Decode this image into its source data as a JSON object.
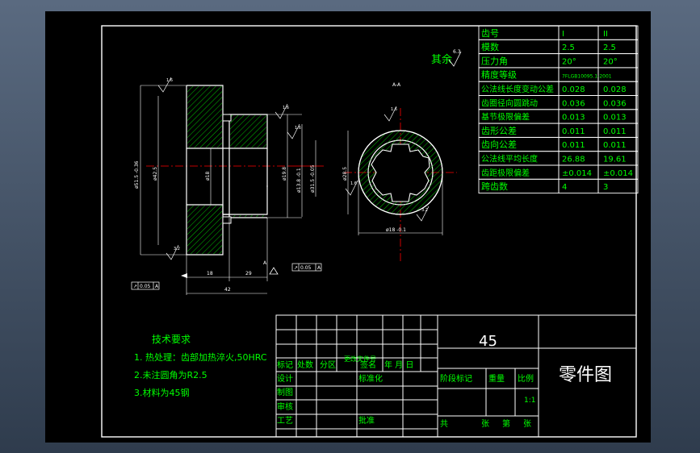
{
  "drawing": {
    "part_label": "零件图",
    "material_code": "45",
    "other_surfaces_label": "其余",
    "roughness_main": "6.3",
    "roughness_values": [
      "1.6",
      "1.6",
      "1.6",
      "3.2",
      "3.2",
      "1.6",
      "3.2",
      "3.2"
    ],
    "section_label": "A-A"
  },
  "main_view": {
    "dims_vertical": [
      "ø51.5 -0.36",
      "ø42.5",
      "ø18",
      "ø19.8",
      "ø13.8 -0.1",
      "ø31.5 -0.05"
    ],
    "dims_horizontal": [
      "18",
      "29",
      "42"
    ],
    "tolerance_frames": [
      {
        "symbol": "↗",
        "value": "0.05",
        "datum": "A"
      },
      {
        "symbol": "↗",
        "value": "0.05",
        "datum": "A"
      }
    ],
    "datum_label": "A"
  },
  "end_view": {
    "dim_bottom": "ø18 -0.1",
    "dim_left": "ø28.5",
    "roughness": [
      "1.6",
      "1.6",
      "3.2"
    ]
  },
  "gear_table": {
    "rows": [
      {
        "label": "齿号",
        "v1": "I",
        "v2": "II"
      },
      {
        "label": "模数",
        "v1": "2.5",
        "v2": "2.5"
      },
      {
        "label": "压力角",
        "v1": "20°",
        "v2": "20°"
      },
      {
        "label": "精度等级",
        "v1": "7FLGB10095.1-2001",
        "v2": ""
      },
      {
        "label": "公法线长度变动公差",
        "v1": "0.028",
        "v2": "0.028"
      },
      {
        "label": "齿圈径向圆跳动",
        "v1": "0.036",
        "v2": "0.036"
      },
      {
        "label": "基节极限偏差",
        "v1": "0.013",
        "v2": "0.013"
      },
      {
        "label": "齿形公差",
        "v1": "0.011",
        "v2": "0.011"
      },
      {
        "label": "齿向公差",
        "v1": "0.011",
        "v2": "0.011"
      },
      {
        "label": "公法线平均长度",
        "v1": "26.88",
        "v2": "19.61"
      },
      {
        "label": "齿距极限偏差",
        "v1": "±0.014",
        "v2": "±0.014"
      },
      {
        "label": "跨齿数",
        "v1": "4",
        "v2": "3"
      }
    ]
  },
  "tech_requirements": {
    "title": "技术要求",
    "items": [
      "1. 热处理：齿部加热淬火,50HRC",
      "2.未注圆角为R2.5",
      "3.材料为45钢"
    ]
  },
  "title_block": {
    "labels": {
      "mark": "标记",
      "count": "处数",
      "zone": "分区",
      "change_doc": "更改文件号",
      "sign": "签名",
      "date": "年 月 日",
      "design": "设计",
      "standard": "标准化",
      "drafting": "制图",
      "review": "审核",
      "process": "工艺",
      "approve": "批准",
      "stage": "阶段标记",
      "weight": "重量",
      "scale": "比例",
      "total": "共",
      "sheet": "张",
      "page": "第",
      "page_unit": "张"
    },
    "scale_value": "1:1"
  },
  "colors": {
    "line": "#ffffff",
    "text": "#00ff00",
    "dim": "#00ffff",
    "center": "#ff0000",
    "hatch": "#00c000",
    "border": "#ffffff",
    "purple": "#b040ff"
  }
}
